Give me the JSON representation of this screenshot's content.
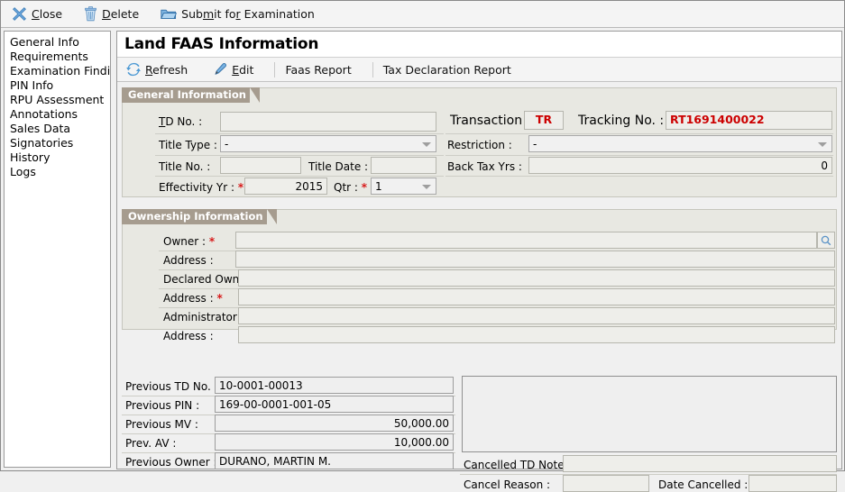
{
  "toolbar": {
    "items": [
      {
        "label_pre": "",
        "label_u": "C",
        "label_post": "lose",
        "full": "Close",
        "icon": "close-x-icon"
      },
      {
        "label_pre": "",
        "label_u": "D",
        "label_post": "elete",
        "full": "Delete",
        "icon": "trash-icon"
      },
      {
        "label_pre": "Sub",
        "label_u": "m",
        "label_post": "it for Examination",
        "full": "Submit for Examination",
        "icon": "folder-icon"
      }
    ]
  },
  "sidebar": {
    "items": [
      {
        "label": "General Info"
      },
      {
        "label": "Requirements"
      },
      {
        "label": "Examination Findings"
      },
      {
        "label": "PIN Info"
      },
      {
        "label": "RPU Assessment"
      },
      {
        "label": "Annotations"
      },
      {
        "label": "Sales Data"
      },
      {
        "label": "Signatories"
      },
      {
        "label": "History"
      },
      {
        "label": "Logs"
      }
    ]
  },
  "page": {
    "title": "Land FAAS Information"
  },
  "subtoolbar": {
    "refresh": "Refresh",
    "edit": "Edit",
    "faas_report": "Faas Report",
    "tax_declaration_report": "Tax Declaration Report"
  },
  "general_information": {
    "header": "General Information",
    "td_no": {
      "label": "TD No. :",
      "value": ""
    },
    "title_type": {
      "label": "Title Type :",
      "value": "-"
    },
    "title_no": {
      "label": "Title No. :",
      "value": ""
    },
    "title_date": {
      "label": "Title Date :",
      "value": ""
    },
    "effectivity_yr": {
      "label": "Effectivity Yr :",
      "required": "*",
      "value": "2015"
    },
    "qtr": {
      "label": "Qtr :",
      "required": "*",
      "value": "1"
    },
    "transaction": {
      "label": "Transaction :",
      "value": "TR"
    },
    "tracking_no": {
      "label": "Tracking No. :",
      "value": "RT1691400022"
    },
    "restriction": {
      "label": "Restriction :",
      "value": "-"
    },
    "back_tax_yrs": {
      "label": "Back Tax Yrs :",
      "value": "0"
    }
  },
  "ownership_information": {
    "header": "Ownership Information",
    "rows": [
      {
        "label": "Owner :",
        "required": "*",
        "value": "",
        "search": "search-icon"
      },
      {
        "label": "Address :",
        "required": "",
        "value": ""
      },
      {
        "label": "Declared Owner :",
        "required": "*",
        "value": ""
      },
      {
        "label": "Address :",
        "required": "*",
        "value": ""
      },
      {
        "label": "Administrator :",
        "required": "",
        "value": ""
      },
      {
        "label": "Address :",
        "required": "",
        "value": ""
      }
    ]
  },
  "previous": {
    "previous_td_no": {
      "label": "Previous TD No. :",
      "value": "10-0001-00013"
    },
    "previous_pin": {
      "label": "Previous PIN :",
      "value": "169-00-0001-001-05"
    },
    "previous_mv": {
      "label": "Previous MV :",
      "value": "50,000.00"
    },
    "prev_av": {
      "label": "Prev. AV :",
      "value": "10,000.00"
    },
    "previous_owner": {
      "label": "Previous Owner :",
      "value": "DURANO, MARTIN M."
    }
  },
  "cancellation": {
    "notes_value": "",
    "cancelled_td_notes": {
      "label": "Cancelled TD Notes :",
      "value": ""
    },
    "cancel_reason": {
      "label": "Cancel Reason :",
      "value": ""
    },
    "date_cancelled": {
      "label": "Date Cancelled :",
      "value": ""
    }
  },
  "colors": {
    "accent_red": "#cc0000",
    "group_header": "#a69c8f",
    "icon_blue": "#5b9bd5",
    "panel_bg": "#e8e8e2"
  }
}
